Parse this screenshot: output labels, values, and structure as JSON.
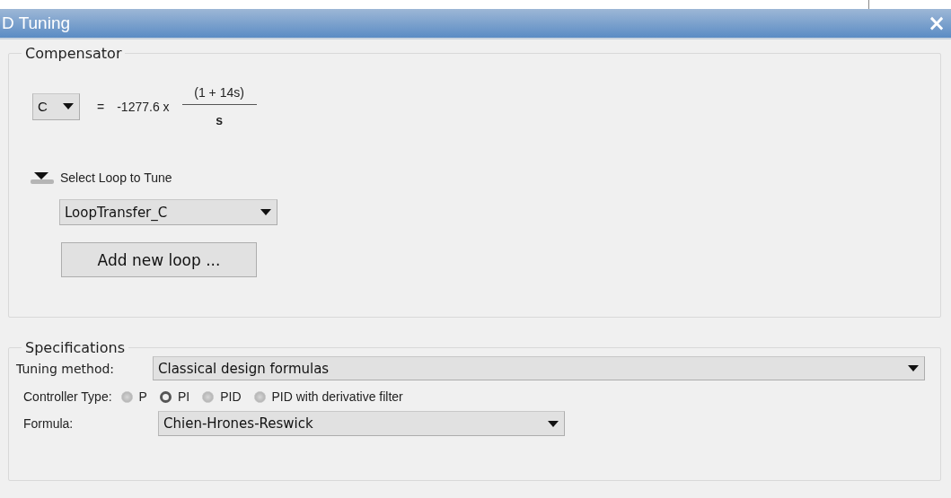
{
  "window": {
    "title": "D Tuning",
    "close": "×"
  },
  "compensator": {
    "title": "Compensator",
    "block": "C",
    "equals": "=",
    "gain": "-1277.6 x",
    "numerator": "(1 + 14s)",
    "denominator": "s",
    "loop_section": {
      "label": "Select Loop to Tune",
      "expanded": true,
      "loop": "LoopTransfer_C",
      "add_button": "Add new loop ..."
    }
  },
  "specifications": {
    "title": "Specifications",
    "tuning_method_label": "Tuning method:",
    "tuning_method": "Classical design formulas",
    "controller_type_label": "Controller Type:",
    "controller_types": [
      {
        "label": "P",
        "selected": false
      },
      {
        "label": "PI",
        "selected": true
      },
      {
        "label": "PID",
        "selected": false
      },
      {
        "label": "PID with derivative filter",
        "selected": false
      }
    ],
    "formula_label": "Formula:",
    "formula": "Chien-Hrones-Reswick"
  }
}
